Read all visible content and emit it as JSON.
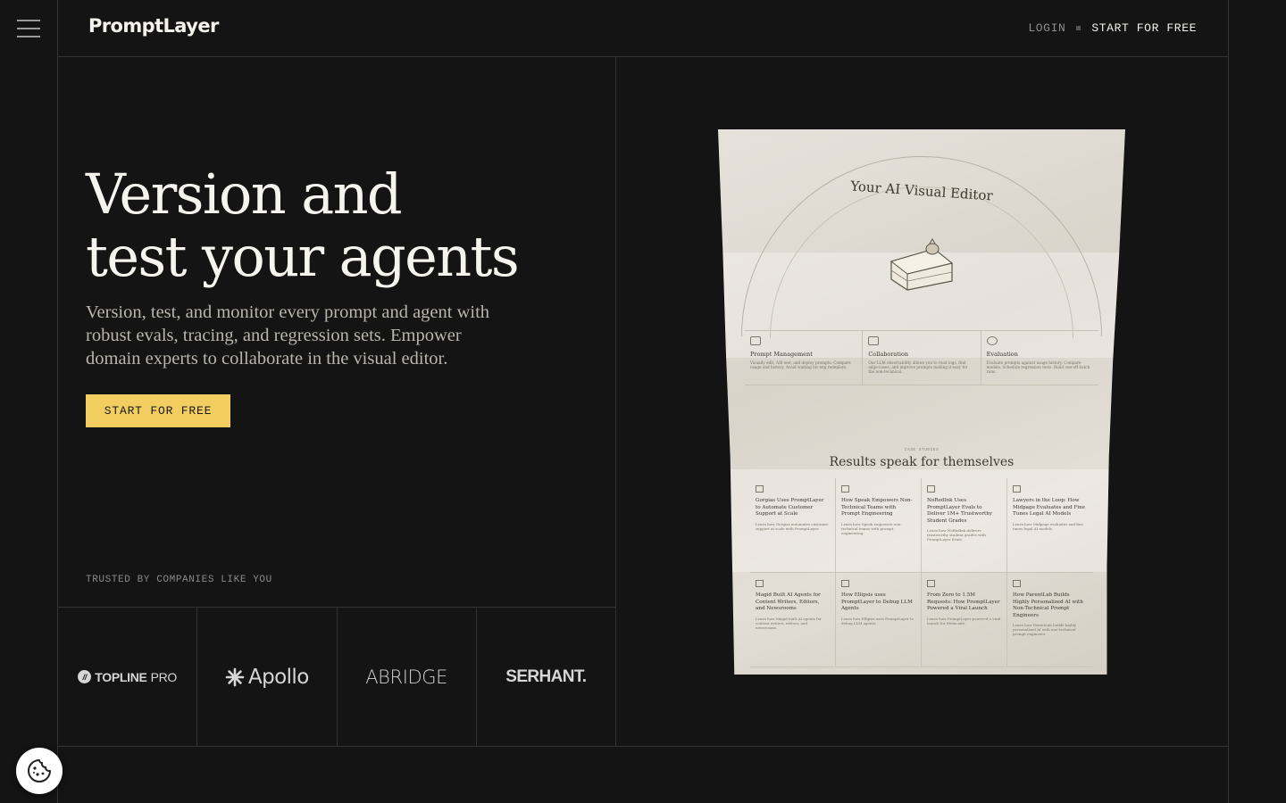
{
  "header": {
    "brand": "PromptLayer",
    "nav": {
      "login": "LOGIN",
      "start": "START FOR FREE"
    }
  },
  "hero": {
    "title_line1": "Version and",
    "title_line2": "test your agents",
    "subtitle": "Version, test, and monitor every prompt and agent with robust evals, tracing, and regression sets. Empower domain experts to collaborate in the visual editor.",
    "cta": "START FOR FREE"
  },
  "trusted": {
    "label": "TRUSTED BY COMPANIES LIKE YOU",
    "logos": [
      {
        "name": "TOPLINE",
        "suffix": "PRO"
      },
      {
        "name": "Apollo"
      },
      {
        "name": "ABRIDGE"
      },
      {
        "name": "SERHANT."
      }
    ]
  },
  "preview": {
    "title": "Your AI Visual Editor",
    "features": [
      {
        "title": "Prompt Management",
        "text": "Visually edit, A/B test, and deploy prompts. Compare usage and history. Avoid waiting for eng redeploys."
      },
      {
        "title": "Collaboration",
        "text": "Our LLM observability allows you to read logs, find edge-cases, and improve prompts making it easy for the non-technical."
      },
      {
        "title": "Evaluation",
        "text": "Evaluate prompts against usage history. Compare models. Schedule regression tests. Build one-off batch runs."
      }
    ],
    "case_label": "CASE STUDIES",
    "results_title": "Results speak for themselves",
    "cases": [
      {
        "title": "Gorgias Uses PromptLayer to Automate Customer Support at Scale",
        "text": "Learn how Gorgias automates customer support at scale with PromptLayer."
      },
      {
        "title": "How Speak Empowers Non-Technical Teams with Prompt Engineering",
        "text": "Learn how Speak empowers non-technical teams with prompt engineering."
      },
      {
        "title": "NoRedInk Uses PromptLayer Evals to Deliver 1M+ Trustworthy Student Grades",
        "text": "Learn how NoRedInk delivers trustworthy student grades with PromptLayer Evals."
      },
      {
        "title": "Lawyers in the Loop: How Midpage Evaluates and Fine Tunes Legal AI Models",
        "text": "Learn how Midpage evaluates and fine tunes legal AI models."
      },
      {
        "title": "Magid Built AI Agents for Content Writers, Editors, and Newsrooms",
        "text": "Learn how Magid built AI agents for content writers, editors, and newsrooms."
      },
      {
        "title": "How Ellipsis uses PromptLayer to Debug LLM Agents",
        "text": "Learn how Ellipsis uses PromptLayer to debug LLM agents."
      },
      {
        "title": "From Zero to 1.5M Requests: How PromptLayer Powered a Viral Launch",
        "text": "Learn how PromptLayer powered a viral launch for Metacade."
      },
      {
        "title": "How ParentLab Builds Highly Personalized AI with Non-Technical Prompt Engineers",
        "text": "Learn how ParentLab builds highly personalized AI with non-technical prompt engineers."
      }
    ]
  },
  "colors": {
    "background": "#141414",
    "accent": "#f2cd5f",
    "border": "#333333"
  }
}
